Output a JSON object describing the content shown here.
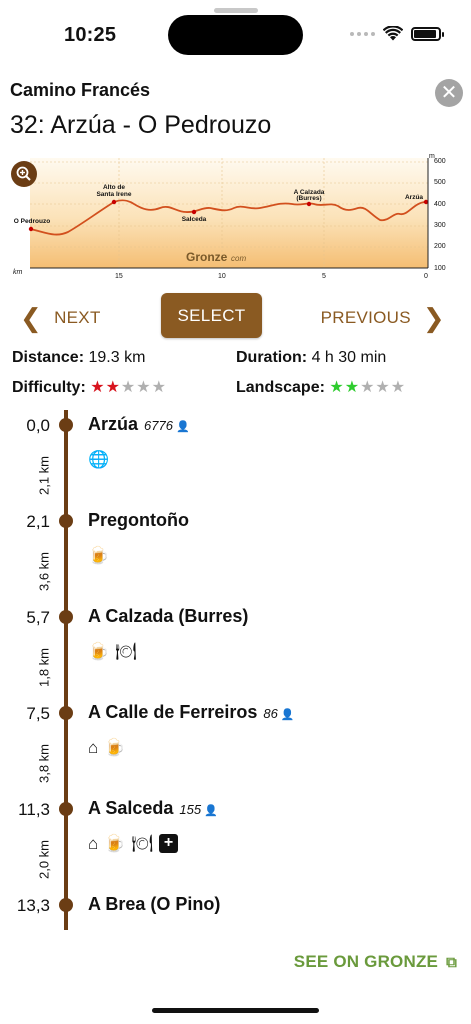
{
  "status": {
    "time": "10:25",
    "battery_level": 0.9
  },
  "header": {
    "route": "Camino Francés",
    "stage_title": "32: Arzúa - O Pedrouzo",
    "close_glyph": "✕"
  },
  "profile": {
    "unit_top": "m",
    "unit_bottom": "km",
    "y_ticks": [
      "600",
      "500",
      "400",
      "300",
      "200",
      "100"
    ],
    "x_ticks": [
      "15",
      "10",
      "5",
      "0"
    ],
    "watermark_main": "Gronze",
    "watermark_sub": "com",
    "places": [
      {
        "name": "O Pedrouzo",
        "line2": ""
      },
      {
        "name": "Alto de",
        "line2": "Santa Irene"
      },
      {
        "name": "Salceda",
        "line2": ""
      },
      {
        "name": "A Calzada",
        "line2": "(Burres)"
      },
      {
        "name": "Arzúa",
        "line2": ""
      }
    ]
  },
  "nav": {
    "next": "NEXT",
    "select": "SELECT",
    "previous": "PREVIOUS",
    "chev_left": "❮",
    "chev_right": "❯"
  },
  "stats": {
    "distance_label": "Distance:",
    "distance_value": "19.3 km",
    "duration_label": "Duration:",
    "duration_value": "4 h 30 min",
    "difficulty_label": "Difficulty:",
    "difficulty_filled": "★★",
    "difficulty_empty": "★★★",
    "landscape_label": "Landscape:",
    "landscape_filled": "★★",
    "landscape_empty": "★★★"
  },
  "stages": [
    {
      "km": "0,0",
      "name": "Arzúa",
      "population": "6776",
      "icons": [
        "globe-icon"
      ],
      "next_segment": "2,1 km"
    },
    {
      "km": "2,1",
      "name": "Pregontoño",
      "population": "",
      "icons": [
        "beer-icon"
      ],
      "next_segment": "3,6 km"
    },
    {
      "km": "5,7",
      "name": "A Calzada (Burres)",
      "population": "",
      "icons": [
        "beer-icon",
        "restaurant-icon"
      ],
      "next_segment": "1,8 km"
    },
    {
      "km": "7,5",
      "name": "A Calle de Ferreiros",
      "population": "86",
      "icons": [
        "house-icon",
        "beer-icon"
      ],
      "next_segment": "3,8 km"
    },
    {
      "km": "11,3",
      "name": "A Salceda",
      "population": "155",
      "icons": [
        "house-icon",
        "beer-icon",
        "restaurant-icon",
        "pharmacy-icon"
      ],
      "next_segment": "2,0 km"
    },
    {
      "km": "13,3",
      "name": "A Brea (O Pino)",
      "population": "",
      "icons": [],
      "next_segment": ""
    }
  ],
  "footer": {
    "link": "SEE ON GRONZE",
    "link_icon": "⧉"
  },
  "colors": {
    "brown": "#8a5a22",
    "timeline": "#6b3d14",
    "green": "#6a9a3c",
    "star_red": "#d8141e",
    "star_green": "#2ecc2e"
  }
}
